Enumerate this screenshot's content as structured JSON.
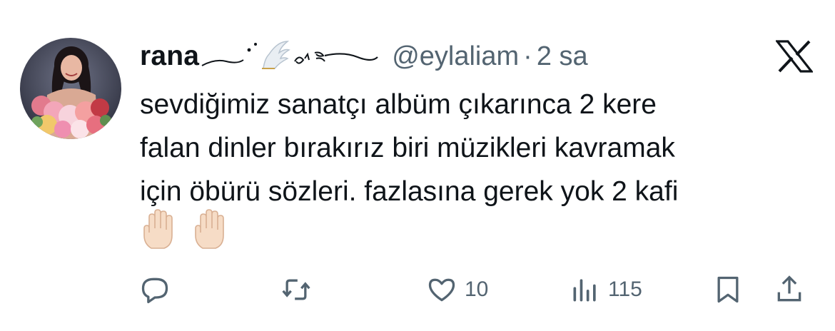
{
  "author": {
    "display_name": "rana",
    "handle": "@eylaliam",
    "separator": "·",
    "timestamp": "2 sa",
    "avatar_icon": "profile-photo-with-flowers"
  },
  "tweet": {
    "lines": [
      "sevdiğimiz sanatçı albüm çıkarınca 2 kere",
      "falan dinler bırakırız biri müzikleri kavramak",
      "için öbürü sözleri. fazlasına gerek yok 2 kafi"
    ],
    "emoji": [
      "raised-hand-emoji",
      "raised-hand-emoji"
    ]
  },
  "actions": {
    "reply": {
      "icon": "reply-icon"
    },
    "retweet": {
      "icon": "retweet-icon"
    },
    "like": {
      "icon": "heart-icon",
      "count": "10"
    },
    "views": {
      "icon": "views-icon",
      "count": "115"
    },
    "bookmark": {
      "icon": "bookmark-icon"
    },
    "share": {
      "icon": "share-icon"
    }
  },
  "colors": {
    "text": "#0f1419",
    "secondary": "#536471",
    "background": "#ffffff"
  }
}
